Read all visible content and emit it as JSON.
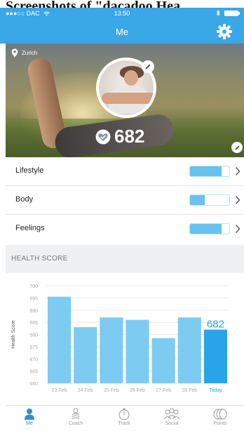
{
  "caption": "Screenshots of \"dacadoo Hea",
  "status_bar": {
    "carrier": "●●●○○ DAC",
    "time": "13:50"
  },
  "nav": {
    "title": "Me"
  },
  "profile": {
    "location": "Zurich",
    "health_score": "682"
  },
  "categories": [
    {
      "label": "Lifestyle",
      "fill": 0.8
    },
    {
      "label": "Body",
      "fill": 0.38
    },
    {
      "label": "Feelings",
      "fill": 0.8
    }
  ],
  "health_score_section": {
    "title": "HEALTH SCORE"
  },
  "chart_data": {
    "type": "bar",
    "ylabel": "Health Score",
    "ylim": [
      660,
      700
    ],
    "yticks": [
      "700",
      "695",
      "690",
      "685",
      "680",
      "675",
      "670",
      "665",
      "660"
    ],
    "categories": [
      "23 Feb",
      "24 Feb",
      "25 Feb",
      "26 Feb",
      "27 Feb",
      "28 Feb",
      "Today"
    ],
    "values": [
      695.5,
      683,
      687,
      686,
      678.5,
      687,
      682
    ],
    "highlight_label": "682",
    "colors": {
      "bar": "#7ecbf1",
      "today": "#2aa4e8",
      "grid": "#e8e8e8"
    }
  },
  "tabs": [
    {
      "label": "Me",
      "icon": "person-icon",
      "active": true
    },
    {
      "label": "Coach",
      "icon": "coach-icon",
      "active": false
    },
    {
      "label": "Track",
      "icon": "stopwatch-icon",
      "active": false
    },
    {
      "label": "Social",
      "icon": "people-icon",
      "active": false
    },
    {
      "label": "Points",
      "icon": "coins-icon",
      "active": false
    }
  ],
  "colors": {
    "accent": "#3aa7e6"
  }
}
